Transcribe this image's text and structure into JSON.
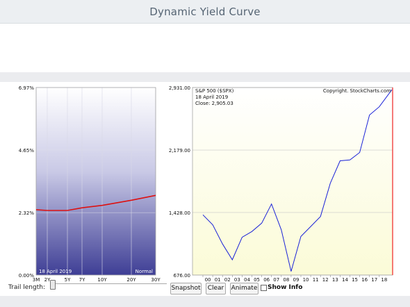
{
  "title": "Dynamic Yield Curve",
  "yield_chart": {
    "y_ticks": [
      "6.97%",
      "4.65%",
      "2.32%",
      "0.00%"
    ],
    "y_values": [
      6.97,
      4.65,
      2.32,
      0.0
    ],
    "x_ticks": [
      "3M",
      "2Y",
      "5Y",
      "7Y",
      "10Y",
      "20Y",
      "30Y"
    ],
    "date_label": "18 April 2019",
    "shape_label": "Normal",
    "curve": [
      {
        "maturity": "3M",
        "yield": 2.43
      },
      {
        "maturity": "2Y",
        "yield": 2.4
      },
      {
        "maturity": "5Y",
        "yield": 2.4
      },
      {
        "maturity": "7Y",
        "yield": 2.5
      },
      {
        "maturity": "10Y",
        "yield": 2.59
      },
      {
        "maturity": "20Y",
        "yield": 2.78
      },
      {
        "maturity": "30Y",
        "yield": 2.96
      }
    ],
    "curve_color": "#dd1111"
  },
  "sp_chart": {
    "title": "S&P 500 ($SPX)",
    "copyright": "Copyright. StockCharts.com",
    "date_label": "18  April 2019",
    "close_label": "Close: 2,905.03",
    "y_ticks": [
      "2,931.00",
      "2,179.00",
      "1,428.00",
      "676.00"
    ],
    "y_values": [
      2931,
      2179,
      1428,
      676
    ],
    "x_ticks": [
      "00",
      "01",
      "02",
      "03",
      "04",
      "05",
      "06",
      "07",
      "08",
      "09",
      "10",
      "11",
      "12",
      "13",
      "14",
      "15",
      "16",
      "17",
      "18"
    ],
    "line_color": "#1a22d8",
    "marker_color": "#ee2222"
  },
  "chart_data": {
    "type": "line",
    "title": "S&P 500 ($SPX)",
    "x_label": "",
    "y_label": "",
    "ylim": [
      676,
      2931
    ],
    "x": [
      "2000",
      "2001",
      "2002",
      "2003",
      "2004",
      "2005",
      "2006",
      "2007",
      "2008",
      "2009",
      "2010",
      "2011",
      "2012",
      "2013",
      "2014",
      "2015",
      "2016",
      "2017",
      "2018",
      "2019-04"
    ],
    "series": [
      {
        "values": [
          1400,
          1280,
          1050,
          860,
          1130,
          1200,
          1300,
          1530,
          1220,
          720,
          1140,
          1260,
          1380,
          1780,
          2050,
          2060,
          2150,
          2600,
          2700,
          2905
        ]
      }
    ]
  },
  "controls": {
    "trail_label": "Trail length:",
    "snapshot": "Snapshot",
    "clear": "Clear",
    "animate": "Animate",
    "show_info": "Show Info"
  }
}
